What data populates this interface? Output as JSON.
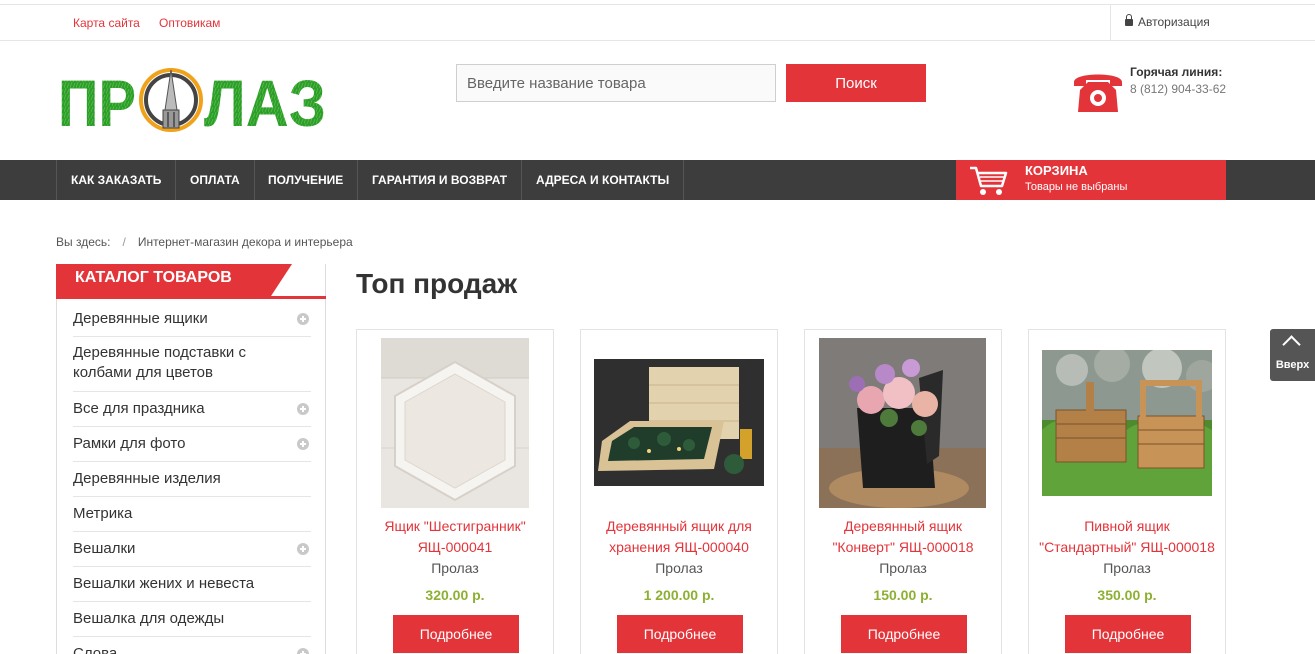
{
  "topbar": {
    "links": [
      "Карта сайта",
      "Оптовикам"
    ],
    "auth_label": "Авторизация"
  },
  "header": {
    "logo_text": "ПРОЛАЗ",
    "search_placeholder": "Введите название товара",
    "search_button": "Поиск",
    "hotline_title": "Горячая линия:",
    "hotline_phone": "8 (812) 904-33-62"
  },
  "nav": {
    "items": [
      "КАК ЗАКАЗАТЬ",
      "ОПЛАТА",
      "ПОЛУЧЕНИЕ",
      "ГАРАНТИЯ И ВОЗВРАТ",
      "АДРЕСА И КОНТАКТЫ"
    ],
    "cart_title": "КОРЗИНА",
    "cart_status": "Товары не выбраны"
  },
  "breadcrumb": {
    "prefix": "Вы здесь:",
    "separator": "/",
    "current": "Интернет-магазин декора и интерьера"
  },
  "catalog": {
    "title": "КАТАЛОГ ТОВАРОВ",
    "items": [
      {
        "label": "Деревянные ящики",
        "expandable": true
      },
      {
        "label": "Деревянные подставки с колбами для цветов",
        "expandable": false
      },
      {
        "label": "Все для праздника",
        "expandable": true
      },
      {
        "label": "Рамки для фото",
        "expandable": true
      },
      {
        "label": "Деревянные изделия",
        "expandable": false
      },
      {
        "label": "Метрика",
        "expandable": false
      },
      {
        "label": "Вешалки",
        "expandable": true
      },
      {
        "label": "Вешалки жених и невеста",
        "expandable": false
      },
      {
        "label": "Вешалка для одежды",
        "expandable": false
      },
      {
        "label": "Слова",
        "expandable": true
      }
    ]
  },
  "main": {
    "title": "Топ продаж",
    "products": [
      {
        "name": "Ящик \"Шестигранник\" ЯЩ-000041",
        "brand": "Пролаз",
        "price": "320.00 р.",
        "button": "Подробнее",
        "image": "hexagon-wooden-tray-photo"
      },
      {
        "name": "Деревянный ящик для хранения ЯЩ-000040",
        "brand": "Пролаз",
        "price": "1 200.00 р.",
        "button": "Подробнее",
        "image": "storage-box-with-fir-branches-photo"
      },
      {
        "name": "Деревянный ящик \"Конверт\" ЯЩ-000018",
        "brand": "Пролаз",
        "price": "150.00 р.",
        "button": "Подробнее",
        "image": "black-box-with-flowers-photo"
      },
      {
        "name": "Пивной ящик \"Стандартный\" ЯЩ-000018",
        "brand": "Пролаз",
        "price": "350.00 р.",
        "button": "Подробнее",
        "image": "beer-crates-on-grass-photo"
      }
    ]
  },
  "scroll_top": {
    "label": "Вверх",
    "icon": "chevron-up-icon"
  },
  "colors": {
    "accent": "#e3343a",
    "nav_bg": "#3d3d3d",
    "price": "#8db033",
    "logo_green": "#2e9b2e"
  }
}
